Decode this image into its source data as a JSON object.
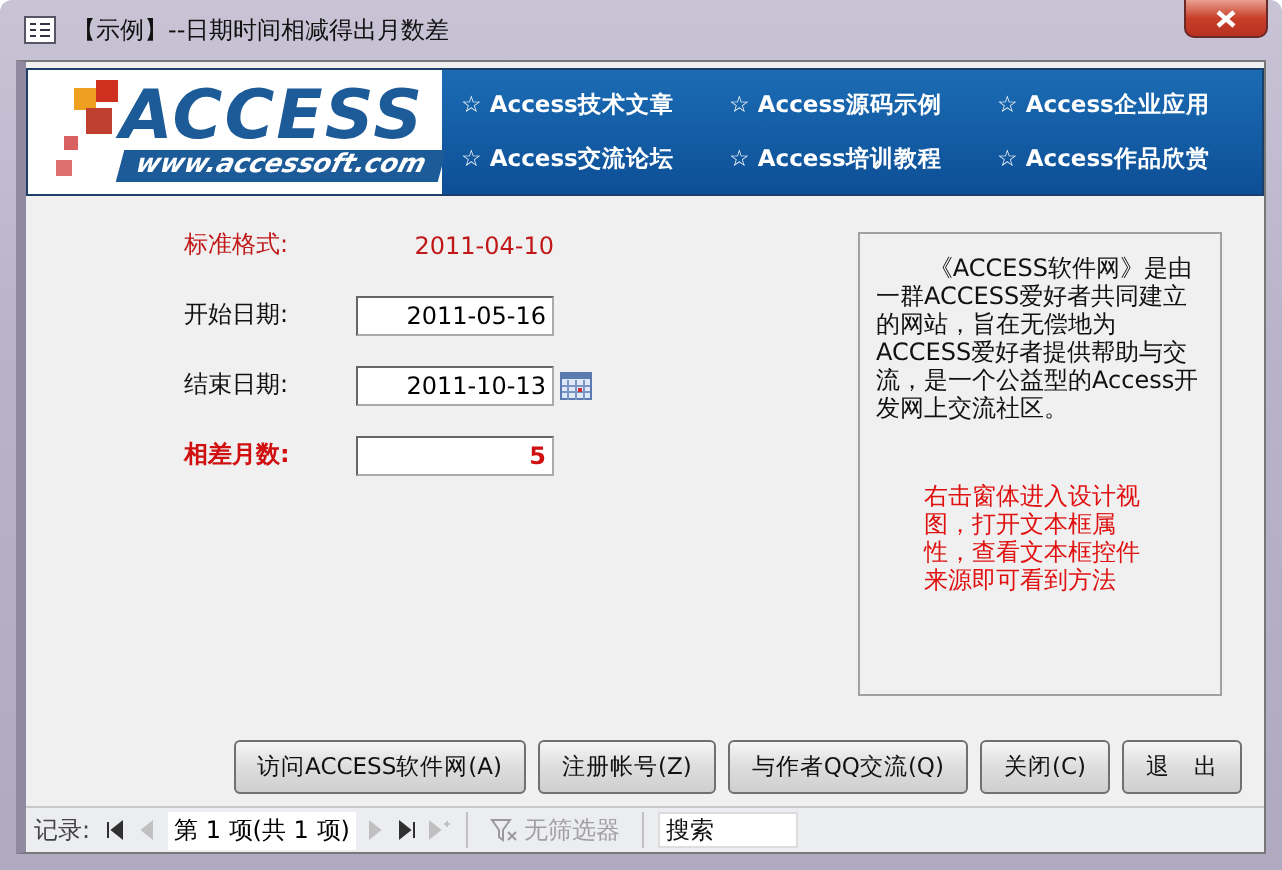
{
  "window": {
    "title": "【示例】--日期时间相减得出月数差"
  },
  "banner": {
    "logo_text": "ACCESS",
    "logo_url": "www.accessoft.com",
    "links": [
      {
        "label": "☆ Access技术文章"
      },
      {
        "label": "☆ Access源码示例"
      },
      {
        "label": "☆ Access企业应用"
      },
      {
        "label": "☆ Access交流论坛"
      },
      {
        "label": "☆ Access培训教程"
      },
      {
        "label": "☆ Access作品欣赏"
      }
    ]
  },
  "form": {
    "fields": [
      {
        "kind": "static",
        "label": "标准格式:",
        "value": "2011-04-10"
      },
      {
        "kind": "input",
        "label": "开始日期:",
        "value": "2011-05-16"
      },
      {
        "kind": "date",
        "label": "结束日期:",
        "value": "2011-10-13"
      },
      {
        "kind": "result",
        "label": "相差月数:",
        "value": "5"
      }
    ]
  },
  "info": {
    "description": "《ACCESS软件网》是由一群ACCESS爱好者共同建立的网站，旨在无偿地为ACCESS爱好者提供帮助与交流，是一个公益型的Access开发网上交流社区。",
    "hint": "右击窗体进入设计视图，打开文本框属性，查看文本框控件来源即可看到方法"
  },
  "buttons": [
    {
      "label": "访问ACCESS软件网(A)"
    },
    {
      "label": "注册帐号(Z)"
    },
    {
      "label": "与作者QQ交流(Q)"
    },
    {
      "label": "关闭(C)"
    },
    {
      "label": "退　出"
    }
  ],
  "record_nav": {
    "label": "记录:",
    "nav_buttons": [
      {
        "kind": "first",
        "disabled": false
      },
      {
        "kind": "prev",
        "disabled": true
      }
    ],
    "position": "第 1 项(共 1 项)",
    "nav_buttons_after": [
      {
        "kind": "next",
        "disabled": true
      },
      {
        "kind": "last",
        "disabled": false
      },
      {
        "kind": "new",
        "disabled": true
      }
    ],
    "filter": "无筛选器",
    "filter_disabled": true,
    "search_placeholder": "搜索"
  }
}
